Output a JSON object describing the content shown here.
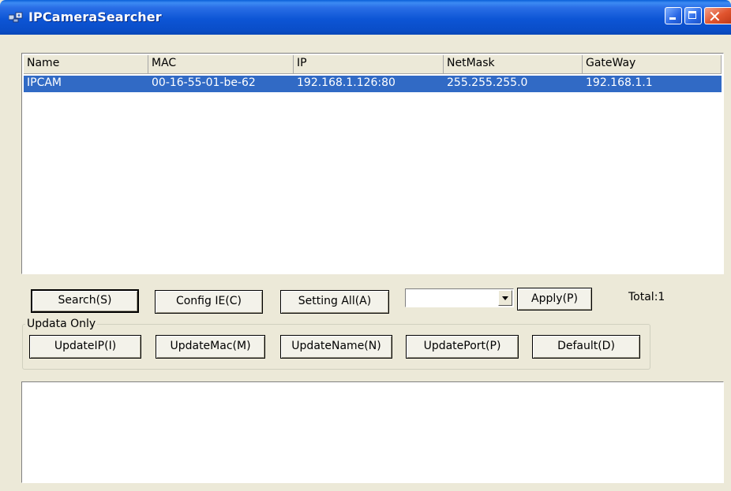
{
  "window": {
    "title": "IPCameraSearcher",
    "icon": "app-icon",
    "controls": {
      "minimize": "minimize-icon",
      "maximize": "maximize-icon",
      "close": "close-icon"
    },
    "colors": {
      "titlebar": "#0a4ec9",
      "selection": "#316ac5",
      "face": "#ece9d8"
    }
  },
  "list": {
    "columns": [
      "Name",
      "MAC",
      "IP",
      "NetMask",
      "GateWay"
    ],
    "rows": [
      {
        "name": "IPCAM",
        "mac": "00-16-55-01-be-62",
        "ip": "192.168.1.126:80",
        "netmask": "255.255.255.0",
        "gateway": "192.168.1.1",
        "selected": true
      }
    ]
  },
  "actions": {
    "search": "Search(S)",
    "config_ie": "Config IE(C)",
    "setting_all": "Setting All(A)",
    "combo_value": "",
    "apply": "Apply(P)",
    "total": "Total:1"
  },
  "update_group": {
    "label": "Updata Only",
    "buttons": {
      "update_ip": "UpdateIP(I)",
      "update_mac": "UpdateMac(M)",
      "update_name": "UpdateName(N)",
      "update_port": "UpdatePort(P)",
      "default": "Default(D)"
    }
  },
  "log": {
    "text": ""
  }
}
